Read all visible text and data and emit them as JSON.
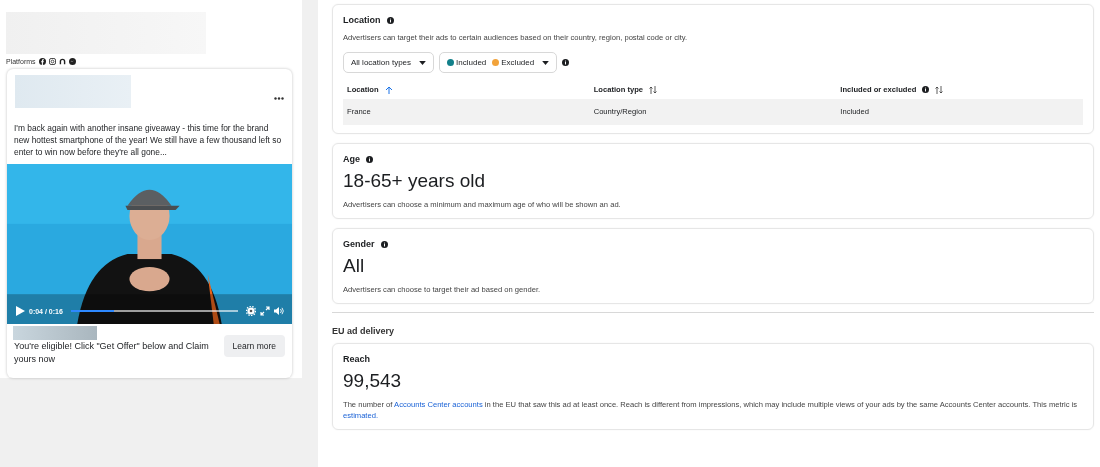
{
  "ad_preview": {
    "platforms_label": "Platforms",
    "body": "I'm back again with another insane giveaway - this time for the brand new hottest smartphone of the year! We still have a few thousand left so enter to win now before they're all gone...",
    "video": {
      "kind": "picture",
      "time": "0:04 / 0:16",
      "level": 0.26
    },
    "cta_text": "You're eligible! Click \"Get Offer\" below and Claim yours now",
    "cta_button": "Learn more"
  },
  "location": {
    "title": "Location",
    "description": "Advertisers can target their ads to certain audiences based on their country, region, postal code or city.",
    "type_filter": "All location types",
    "status_filter": [
      {
        "label": "Included",
        "color": "#12808a"
      },
      {
        "label": "Excluded",
        "color": "#f2a33a"
      }
    ],
    "columns": [
      {
        "label": "Location",
        "sorted": true,
        "info": false
      },
      {
        "label": "Location type",
        "sorted": false,
        "info": false
      },
      {
        "label": "Included or excluded",
        "sorted": false,
        "info": true
      }
    ],
    "rows": [
      [
        "France",
        "Country/Region",
        "Included"
      ]
    ]
  },
  "age": {
    "title": "Age",
    "value": "18-65+ years old",
    "description": "Advertisers can choose a minimum and maximum age of who will be shown an ad."
  },
  "gender": {
    "title": "Gender",
    "value": "All",
    "description": "Advertisers can choose to target their ad based on gender."
  },
  "eu_heading": "EU ad delivery",
  "reach": {
    "title": "Reach",
    "value": "99,543",
    "description": [
      {
        "text": "The number of ",
        "link": false
      },
      {
        "text": "Accounts Center accounts",
        "link": true
      },
      {
        "text": " in the EU that saw this ad at least once. Reach is different from impressions, which may include multiple views of your ads by the same Accounts Center accounts. This metric is ",
        "link": false
      },
      {
        "text": "estimated.",
        "link": true
      }
    ]
  }
}
